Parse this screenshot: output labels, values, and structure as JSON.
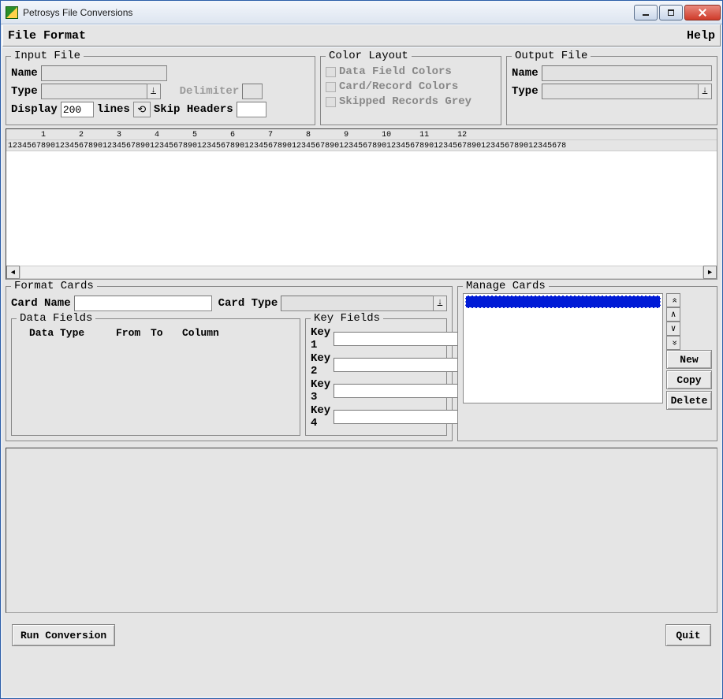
{
  "window": {
    "title": "Petrosys File Conversions"
  },
  "menubar": {
    "file_format": "File Format",
    "help": "Help"
  },
  "input_file": {
    "legend": "Input File",
    "name_label": "Name",
    "name_value": "",
    "type_label": "Type",
    "type_value": "",
    "delimiter_label": "Delimiter",
    "delimiter_value": "",
    "display_label": "Display",
    "display_value": "200",
    "lines_label": "lines",
    "skip_headers_label": "Skip Headers",
    "skip_headers_value": ""
  },
  "color_layout": {
    "legend": "Color Layout",
    "opt_data_field": "Data Field Colors",
    "opt_card": "Card/Record Colors",
    "opt_skipped": "Skipped Records Grey"
  },
  "output_file": {
    "legend": "Output File",
    "name_label": "Name",
    "name_value": "",
    "type_label": "Type",
    "type_value": ""
  },
  "ruler": {
    "tens": "       1       2       3       4       5       6       7       8       9       10      11      12",
    "units": "1234567890123456789012345678901234567890123456789012345678901234567890123456789012345678901234567890123456789012345678"
  },
  "format_cards": {
    "legend": "Format Cards",
    "card_name_label": "Card Name",
    "card_name_value": "",
    "card_type_label": "Card Type",
    "card_type_value": ""
  },
  "data_fields": {
    "legend": "Data Fields",
    "hdr_data_type": "Data Type",
    "hdr_from": "From",
    "hdr_to": "To",
    "hdr_column": "Column"
  },
  "key_fields": {
    "legend": "Key Fields",
    "k1_label": "Key 1",
    "k1_value": "",
    "k2_label": "Key 2",
    "k2_value": "",
    "k3_label": "Key 3",
    "k3_value": "",
    "k4_label": "Key 4",
    "k4_value": ""
  },
  "manage_cards": {
    "legend": "Manage Cards",
    "new_label": "New",
    "copy_label": "Copy",
    "delete_label": "Delete"
  },
  "bottom": {
    "run": "Run Conversion",
    "quit": "Quit"
  }
}
